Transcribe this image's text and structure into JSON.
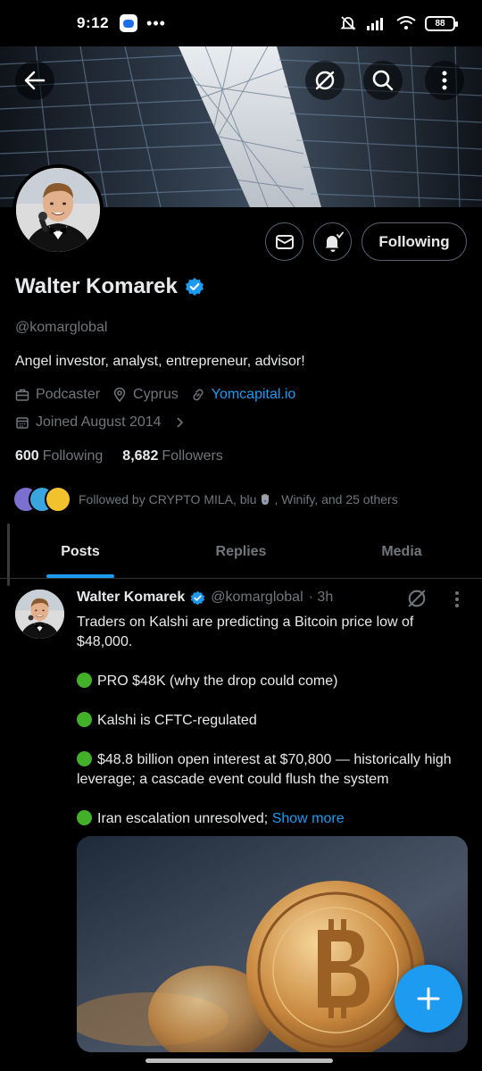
{
  "status_bar": {
    "time": "9:12",
    "dots": "•••",
    "battery": "88"
  },
  "header": {
    "back_icon": "arrow-left-icon",
    "grok_icon": "grok-icon",
    "search_icon": "search-icon",
    "more_icon": "more-vertical-icon"
  },
  "profile": {
    "name": "Walter Komarek",
    "handle": "@komarglobal",
    "bio": "Angel investor, analyst, entrepreneur, advisor!",
    "profession": "Podcaster",
    "location": "Cyprus",
    "website": "Yomcapital.io",
    "joined": "Joined August 2014",
    "following_count": "600",
    "following_label": "Following",
    "followers_count": "8,682",
    "followers_label": "Followers",
    "followed_by_prefix": "Followed by CRYPTO MILA, blu",
    "followed_by_suffix": ", Winify, and 25 others",
    "follow_button": "Following"
  },
  "tabs": [
    {
      "label": "Posts",
      "active": true
    },
    {
      "label": "Replies",
      "active": false
    },
    {
      "label": "Media",
      "active": false
    }
  ],
  "post": {
    "author": "Walter Komarek",
    "handle": "@komarglobal",
    "time": "· 3h",
    "line1": "Traders on Kalshi are predicting a Bitcoin price low of $48,000.",
    "bullet1": "PRO $48K (why the drop could come)",
    "bullet2": "Kalshi is CFTC-regulated",
    "bullet3": "$48.8 billion open interest at $70,800 — historically high leverage; a cascade event could flush the system",
    "bullet4": "Iran escalation unresolved;",
    "show_more": "Show more"
  },
  "colors": {
    "accent": "#1d9bf0",
    "background": "#000000",
    "text_primary": "#e7e9ea",
    "text_secondary": "#71767b",
    "bullet": "#43b02a"
  }
}
